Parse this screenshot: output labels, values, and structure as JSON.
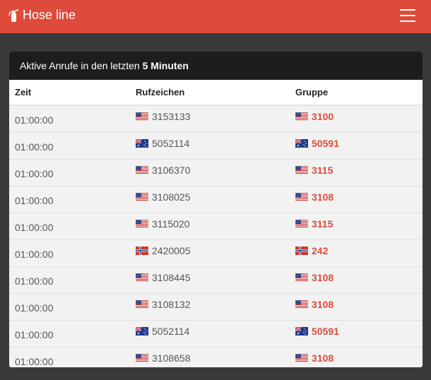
{
  "navbar": {
    "brand": "Hose line",
    "brand_icon": "fire-extinguisher-icon",
    "accent": "#de4b3b"
  },
  "panel": {
    "heading_prefix": "Aktive Anrufe in den letzten ",
    "heading_bold": "5 Minuten"
  },
  "table": {
    "headers": [
      "Zeit",
      "Rufzeichen",
      "Gruppe"
    ],
    "rows": [
      {
        "time": "01:00:00",
        "callsign": "3153133",
        "callsign_flag": "us",
        "group": "3100",
        "group_flag": "us"
      },
      {
        "time": "01:00:00",
        "callsign": "5052114",
        "callsign_flag": "au",
        "group": "50591",
        "group_flag": "au"
      },
      {
        "time": "01:00:00",
        "callsign": "3106370",
        "callsign_flag": "us",
        "group": "3115",
        "group_flag": "us"
      },
      {
        "time": "01:00:00",
        "callsign": "3108025",
        "callsign_flag": "us",
        "group": "3108",
        "group_flag": "us"
      },
      {
        "time": "01:00:00",
        "callsign": "3115020",
        "callsign_flag": "us",
        "group": "3115",
        "group_flag": "us"
      },
      {
        "time": "01:00:00",
        "callsign": "2420005",
        "callsign_flag": "no",
        "group": "242",
        "group_flag": "no"
      },
      {
        "time": "01:00:00",
        "callsign": "3108445",
        "callsign_flag": "us",
        "group": "3108",
        "group_flag": "us"
      },
      {
        "time": "01:00:00",
        "callsign": "3108132",
        "callsign_flag": "us",
        "group": "3108",
        "group_flag": "us"
      },
      {
        "time": "01:00:00",
        "callsign": "5052114",
        "callsign_flag": "au",
        "group": "50591",
        "group_flag": "au"
      },
      {
        "time": "01:00:00",
        "callsign": "3108658",
        "callsign_flag": "us",
        "group": "3108",
        "group_flag": "us"
      }
    ]
  }
}
